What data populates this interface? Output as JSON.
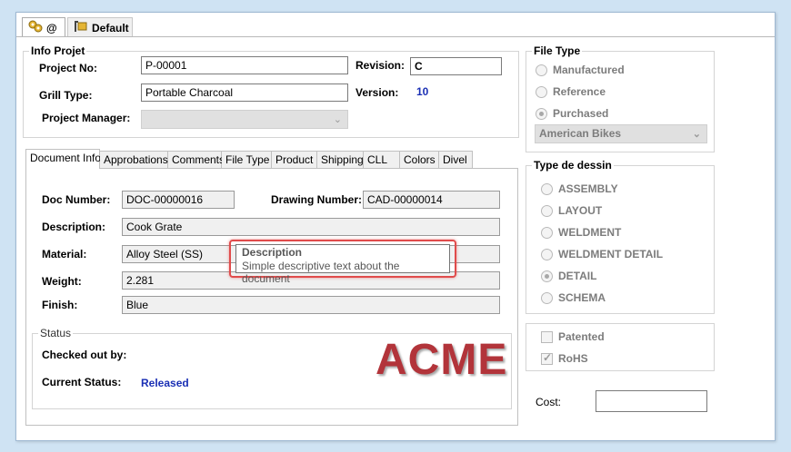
{
  "top_tabs": [
    {
      "label": "@",
      "icon": "gears-icon"
    },
    {
      "label": "Default",
      "icon": "config-icon"
    }
  ],
  "info_projet": {
    "title": "Info Projet",
    "project_no_label": "Project No:",
    "project_no": "P-00001",
    "revision_label": "Revision:",
    "revision": "C",
    "grill_type_label": "Grill Type:",
    "grill_type": "Portable Charcoal",
    "version_label": "Version:",
    "version": "10",
    "project_manager_label": "Project Manager:",
    "project_manager": ""
  },
  "doc_tabs": [
    "Document Info",
    "Approbations",
    "Comments",
    "File Type",
    "Product",
    "Shipping",
    "CLL",
    "Colors",
    "Divel"
  ],
  "document_info": {
    "doc_number_label": "Doc Number:",
    "doc_number": "DOC-00000016",
    "drawing_number_label": "Drawing Number:",
    "drawing_number": "CAD-00000014",
    "description_label": "Description:",
    "description": "Cook Grate",
    "material_label": "Material:",
    "material": "Alloy Steel (SS)",
    "weight_label": "Weight:",
    "weight": "2.281",
    "finish_label": "Finish:",
    "finish": "Blue"
  },
  "tooltip": {
    "title": "Description",
    "text": "Simple descriptive text about the document"
  },
  "status": {
    "title": "Status",
    "checked_out_label": "Checked out by:",
    "checked_out": "",
    "current_status_label": "Current Status:",
    "current_status": "Released"
  },
  "logo": "ACME",
  "file_type": {
    "title": "File Type",
    "options": [
      "Manufactured",
      "Reference",
      "Purchased"
    ],
    "selected": "Purchased",
    "vendor": "American Bikes"
  },
  "type_de_dessin": {
    "title": "Type de dessin",
    "options": [
      "ASSEMBLY",
      "LAYOUT",
      "WELDMENT",
      "WELDMENT DETAIL",
      "DETAIL",
      "SCHEMA"
    ],
    "selected": "DETAIL"
  },
  "flags": {
    "patented_label": "Patented",
    "patented": false,
    "rohs_label": "RoHS",
    "rohs": true
  },
  "cost": {
    "label": "Cost:",
    "value": ""
  },
  "colors": {
    "accent_blue": "#1a2fb4",
    "logo_red": "#b2343a",
    "highlight_red": "#e04b4b"
  }
}
